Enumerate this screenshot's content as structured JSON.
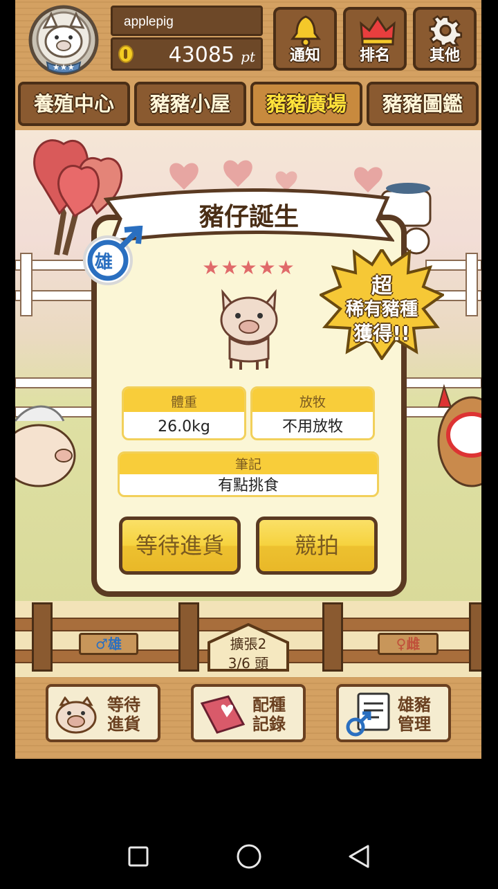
{
  "player": {
    "name": "applepig",
    "points": "43085",
    "points_unit": "pt"
  },
  "top_buttons": {
    "notify": "通知",
    "ranking": "排名",
    "other": "其他"
  },
  "tabs": [
    "養殖中心",
    "豬豬小屋",
    "豬豬廣場",
    "豬豬圖鑑"
  ],
  "active_tab": "豬豬廣場",
  "dialog": {
    "title": "豬仔誕生",
    "gender": "雄",
    "stars": "★★★★★",
    "rare_badge": {
      "line1": "超",
      "line2": "稀有豬種",
      "line3": "獲得!!"
    },
    "weight_label": "體重",
    "weight_value": "26.0kg",
    "graze_label": "放牧",
    "graze_value": "不用放牧",
    "note_label": "筆記",
    "note_value": "有點挑食",
    "wait_button": "等待進貨",
    "auction_button": "競拍"
  },
  "pen": {
    "male_sign": "♂雄",
    "female_sign": "♀雌",
    "expand_label": "擴張2",
    "count": "3/6 頭"
  },
  "bottom_buttons": {
    "wait": "等待進貨",
    "breeding": "配種記錄",
    "boar": "雄豬管理"
  },
  "colors": {
    "wood": "#d4a162",
    "dark_wood": "#4a2e16",
    "yellow": "#f6d23e",
    "male_blue": "#2a6fc0",
    "star": "#e06a6a"
  }
}
